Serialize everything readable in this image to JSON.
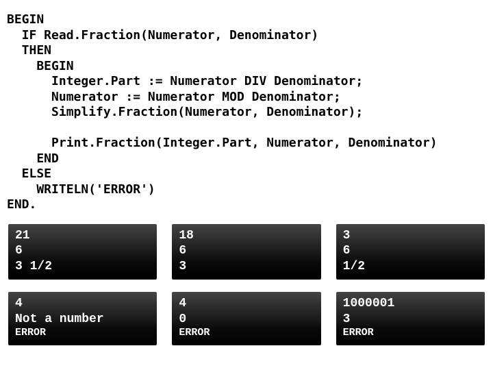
{
  "code": {
    "l01": "BEGIN",
    "l02": "  IF Read.Fraction(Numerator, Denominator)",
    "l03": "  THEN",
    "l04": "    BEGIN",
    "l05": "      Integer.Part := Numerator DIV Denominator;",
    "l06": "      Numerator := Numerator MOD Denominator;",
    "l07": "      Simplify.Fraction(Numerator, Denominator);",
    "l08": "",
    "l09": "      Print.Fraction(Integer.Part, Numerator, Denominator)",
    "l10": "    END",
    "l11": "  ELSE",
    "l12": "    WRITELN('ERROR')",
    "l13": "END."
  },
  "cells": [
    {
      "in1": "21",
      "in2": "6",
      "out": "3 1/2"
    },
    {
      "in1": "18",
      "in2": "6",
      "out": "3"
    },
    {
      "in1": "3",
      "in2": "6",
      "out": "1/2"
    },
    {
      "in1": "4",
      "in2": "Not a number",
      "out": "ERROR"
    },
    {
      "in1": "4",
      "in2": "0",
      "out": "ERROR"
    },
    {
      "in1": "1000001",
      "in2": "3",
      "out": "ERROR"
    }
  ]
}
